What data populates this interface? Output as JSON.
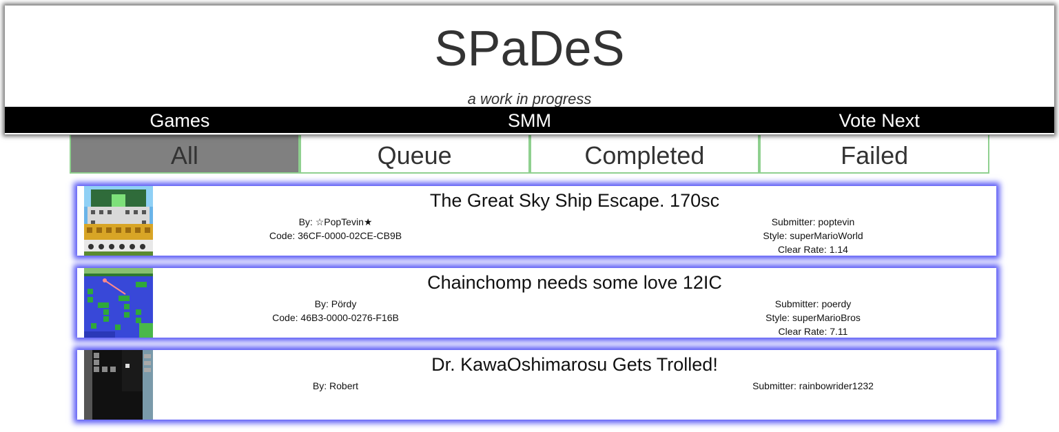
{
  "site": {
    "title": "SPaDeS",
    "subtitle": "a work in progress"
  },
  "nav": {
    "items": [
      "Games",
      "SMM",
      "Vote Next"
    ]
  },
  "filters": {
    "tabs": [
      "All",
      "Queue",
      "Completed",
      "Failed"
    ],
    "active": "All"
  },
  "colors": {
    "nav_bg": "#000000",
    "active_tab_bg": "#808080",
    "tab_border": "#8fd08f",
    "card_glow": "#5858f5"
  },
  "levels": [
    {
      "title": "The Great Sky Ship Escape. 170sc",
      "by": "By: ☆PopTevin★",
      "code": "Code: 36CF-0000-02CE-CB9B",
      "submitter": "Submitter: poptevin",
      "style": "Style: superMarioWorld",
      "clear_rate": "Clear Rate: 1.14"
    },
    {
      "title": "Chainchomp needs some love 12IC",
      "by": "By: Pördy",
      "code": "Code: 46B3-0000-0276-F16B",
      "submitter": "Submitter: poerdy",
      "style": "Style: superMarioBros",
      "clear_rate": "Clear Rate: 7.11"
    },
    {
      "title": "Dr. KawaOshimarosu Gets Trolled!",
      "by": "By: Robert",
      "submitter": "Submitter: rainbowrider1232"
    }
  ]
}
